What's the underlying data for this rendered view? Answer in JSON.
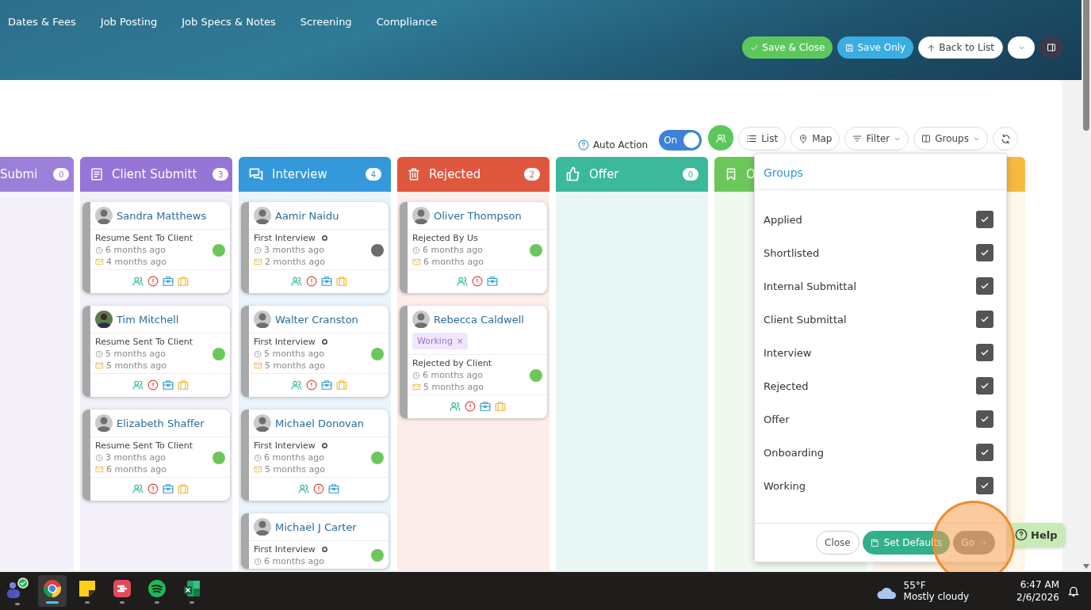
{
  "nav_tabs": [
    "Dates & Fees",
    "Job Posting",
    "Job Specs & Notes",
    "Screening",
    "Compliance"
  ],
  "header_buttons": [
    {
      "kind": "save_close",
      "label": "Save & Close"
    },
    {
      "kind": "save",
      "label": "Save Only"
    },
    {
      "kind": "back",
      "label": "Back to List"
    },
    {
      "kind": "more"
    },
    {
      "kind": "panel"
    }
  ],
  "toolbar": {
    "auto_action": {
      "label": "Auto Action",
      "state_label": "On",
      "on": true
    },
    "buttons": [
      {
        "kind": "people"
      },
      {
        "kind": "list",
        "label": "List"
      },
      {
        "kind": "map",
        "label": "Map"
      },
      {
        "kind": "filter",
        "label": "Filter"
      },
      {
        "kind": "groups",
        "label": "Groups"
      },
      {
        "kind": "refresh"
      }
    ]
  },
  "columns": [
    {
      "kind": "partial",
      "title": "Submi",
      "count": "0",
      "color": "#9b7fd9"
    },
    {
      "kind": "form",
      "title": "Client Submitt",
      "count": "3",
      "color": "#9575d6",
      "cards": [
        {
          "name": "Sandra Matthews",
          "kind": "placeholder",
          "stage": "Resume Sent To Client",
          "stage_dot": false,
          "contacted": "6 months ago",
          "emailed": "4 months ago",
          "color": "#6cc75a",
          "icons": [
            {
              "kind": "people"
            },
            {
              "kind": "alert"
            },
            {
              "kind": "medkit"
            },
            {
              "kind": "briefcase"
            }
          ]
        },
        {
          "name": "Tim Mitchell",
          "kind": "photo",
          "stage": "Resume Sent To Client",
          "stage_dot": false,
          "contacted": "5 months ago",
          "emailed": "5 months ago",
          "color": "#6cc75a",
          "icons": [
            {
              "kind": "people"
            },
            {
              "kind": "alert"
            },
            {
              "kind": "medkit"
            },
            {
              "kind": "briefcase"
            }
          ]
        },
        {
          "name": "Elizabeth Shaffer",
          "kind": "placeholder",
          "stage": "Resume Sent To Client",
          "stage_dot": false,
          "contacted": "3 months ago",
          "emailed": "6 months ago",
          "color": "#6cc75a",
          "icons": [
            {
              "kind": "people"
            },
            {
              "kind": "alert"
            },
            {
              "kind": "medkit"
            },
            {
              "kind": "briefcase"
            }
          ]
        }
      ]
    },
    {
      "kind": "chat",
      "title": "Interview",
      "count": "4",
      "color": "#3498db",
      "cards": [
        {
          "name": "Aamir Naidu",
          "kind": "placeholder",
          "stage": "First Interview",
          "stage_dot": true,
          "contacted": "3 months ago",
          "emailed": "2 months ago",
          "color": "#6b6b6b",
          "icons": [
            {
              "kind": "people"
            },
            {
              "kind": "alert"
            },
            {
              "kind": "medkit"
            },
            {
              "kind": "briefcase"
            }
          ]
        },
        {
          "name": "Walter Cranston",
          "kind": "placeholder",
          "stage": "First Interview",
          "stage_dot": true,
          "contacted": "5 months ago",
          "emailed": "5 months ago",
          "color": "#6cc75a",
          "icons": [
            {
              "kind": "people"
            },
            {
              "kind": "alert"
            },
            {
              "kind": "medkit"
            },
            {
              "kind": "briefcase"
            }
          ]
        },
        {
          "name": "Michael Donovan",
          "kind": "placeholder",
          "stage": "First Interview",
          "stage_dot": true,
          "contacted": "6 months ago",
          "emailed": "5 months ago",
          "color": "#6cc75a",
          "icons": [
            {
              "kind": "people"
            },
            {
              "kind": "alert"
            },
            {
              "kind": "medkit"
            }
          ]
        },
        {
          "name": "Michael J Carter",
          "kind": "placeholder",
          "stage": "First Interview",
          "stage_dot": true,
          "contacted": "6 months ago",
          "color": "#6cc75a"
        }
      ]
    },
    {
      "kind": "trash",
      "title": "Rejected",
      "count": "2",
      "color": "#e0573f",
      "cards": [
        {
          "name": "Oliver Thompson",
          "kind": "placeholder",
          "stage": "Rejected By Us",
          "stage_dot": false,
          "contacted": "6 months ago",
          "emailed": "6 months ago",
          "color": "#6cc75a",
          "icons": [
            {
              "kind": "people"
            },
            {
              "kind": "alert"
            },
            {
              "kind": "medkit"
            }
          ]
        },
        {
          "name": "Rebecca Caldwell",
          "kind": "placeholder",
          "tag": "Working",
          "tag_remove": "×",
          "stage": "Rejected by Client",
          "stage_dot": false,
          "contacted": "6 months ago",
          "emailed": "5 months ago",
          "color": "#6cc75a",
          "icons": [
            {
              "kind": "people"
            },
            {
              "kind": "alert"
            },
            {
              "kind": "medkit"
            },
            {
              "kind": "briefcase"
            }
          ]
        }
      ]
    },
    {
      "kind": "thumb",
      "title": "Offer",
      "count": "0",
      "color": "#3bb99a"
    },
    {
      "kind": "bookmark",
      "title": "O",
      "color": "#6cc75a"
    },
    {
      "kind": "blank",
      "color": "#f6b940"
    }
  ],
  "groups_menu": {
    "title": "Groups",
    "items": [
      {
        "label": "Applied",
        "checked": true
      },
      {
        "label": "Shortlisted",
        "checked": true
      },
      {
        "label": "Internal Submittal",
        "checked": true
      },
      {
        "label": "Client Submittal",
        "checked": true
      },
      {
        "label": "Interview",
        "checked": true
      },
      {
        "label": "Rejected",
        "checked": true
      },
      {
        "label": "Offer",
        "checked": true
      },
      {
        "label": "Onboarding",
        "checked": true
      },
      {
        "label": "Working",
        "checked": true
      }
    ],
    "buttons": [
      {
        "kind": "close",
        "label": "Close"
      },
      {
        "kind": "defaults",
        "label": "Set Defaults"
      },
      {
        "kind": "go",
        "label": "Go"
      }
    ]
  },
  "help_button": "Help",
  "taskbar": {
    "apps": [
      {
        "kind": "teams",
        "selected": false
      },
      {
        "kind": "chrome",
        "selected": true
      },
      {
        "kind": "sticky",
        "selected": false
      },
      {
        "kind": "stripes",
        "selected": false
      },
      {
        "kind": "spotify",
        "selected": false
      },
      {
        "kind": "excel",
        "selected": false
      }
    ],
    "weather": {
      "temperature": "55°F",
      "condition": "Mostly cloudy"
    },
    "time": "6:47 AM",
    "date": "2/6/2026"
  }
}
